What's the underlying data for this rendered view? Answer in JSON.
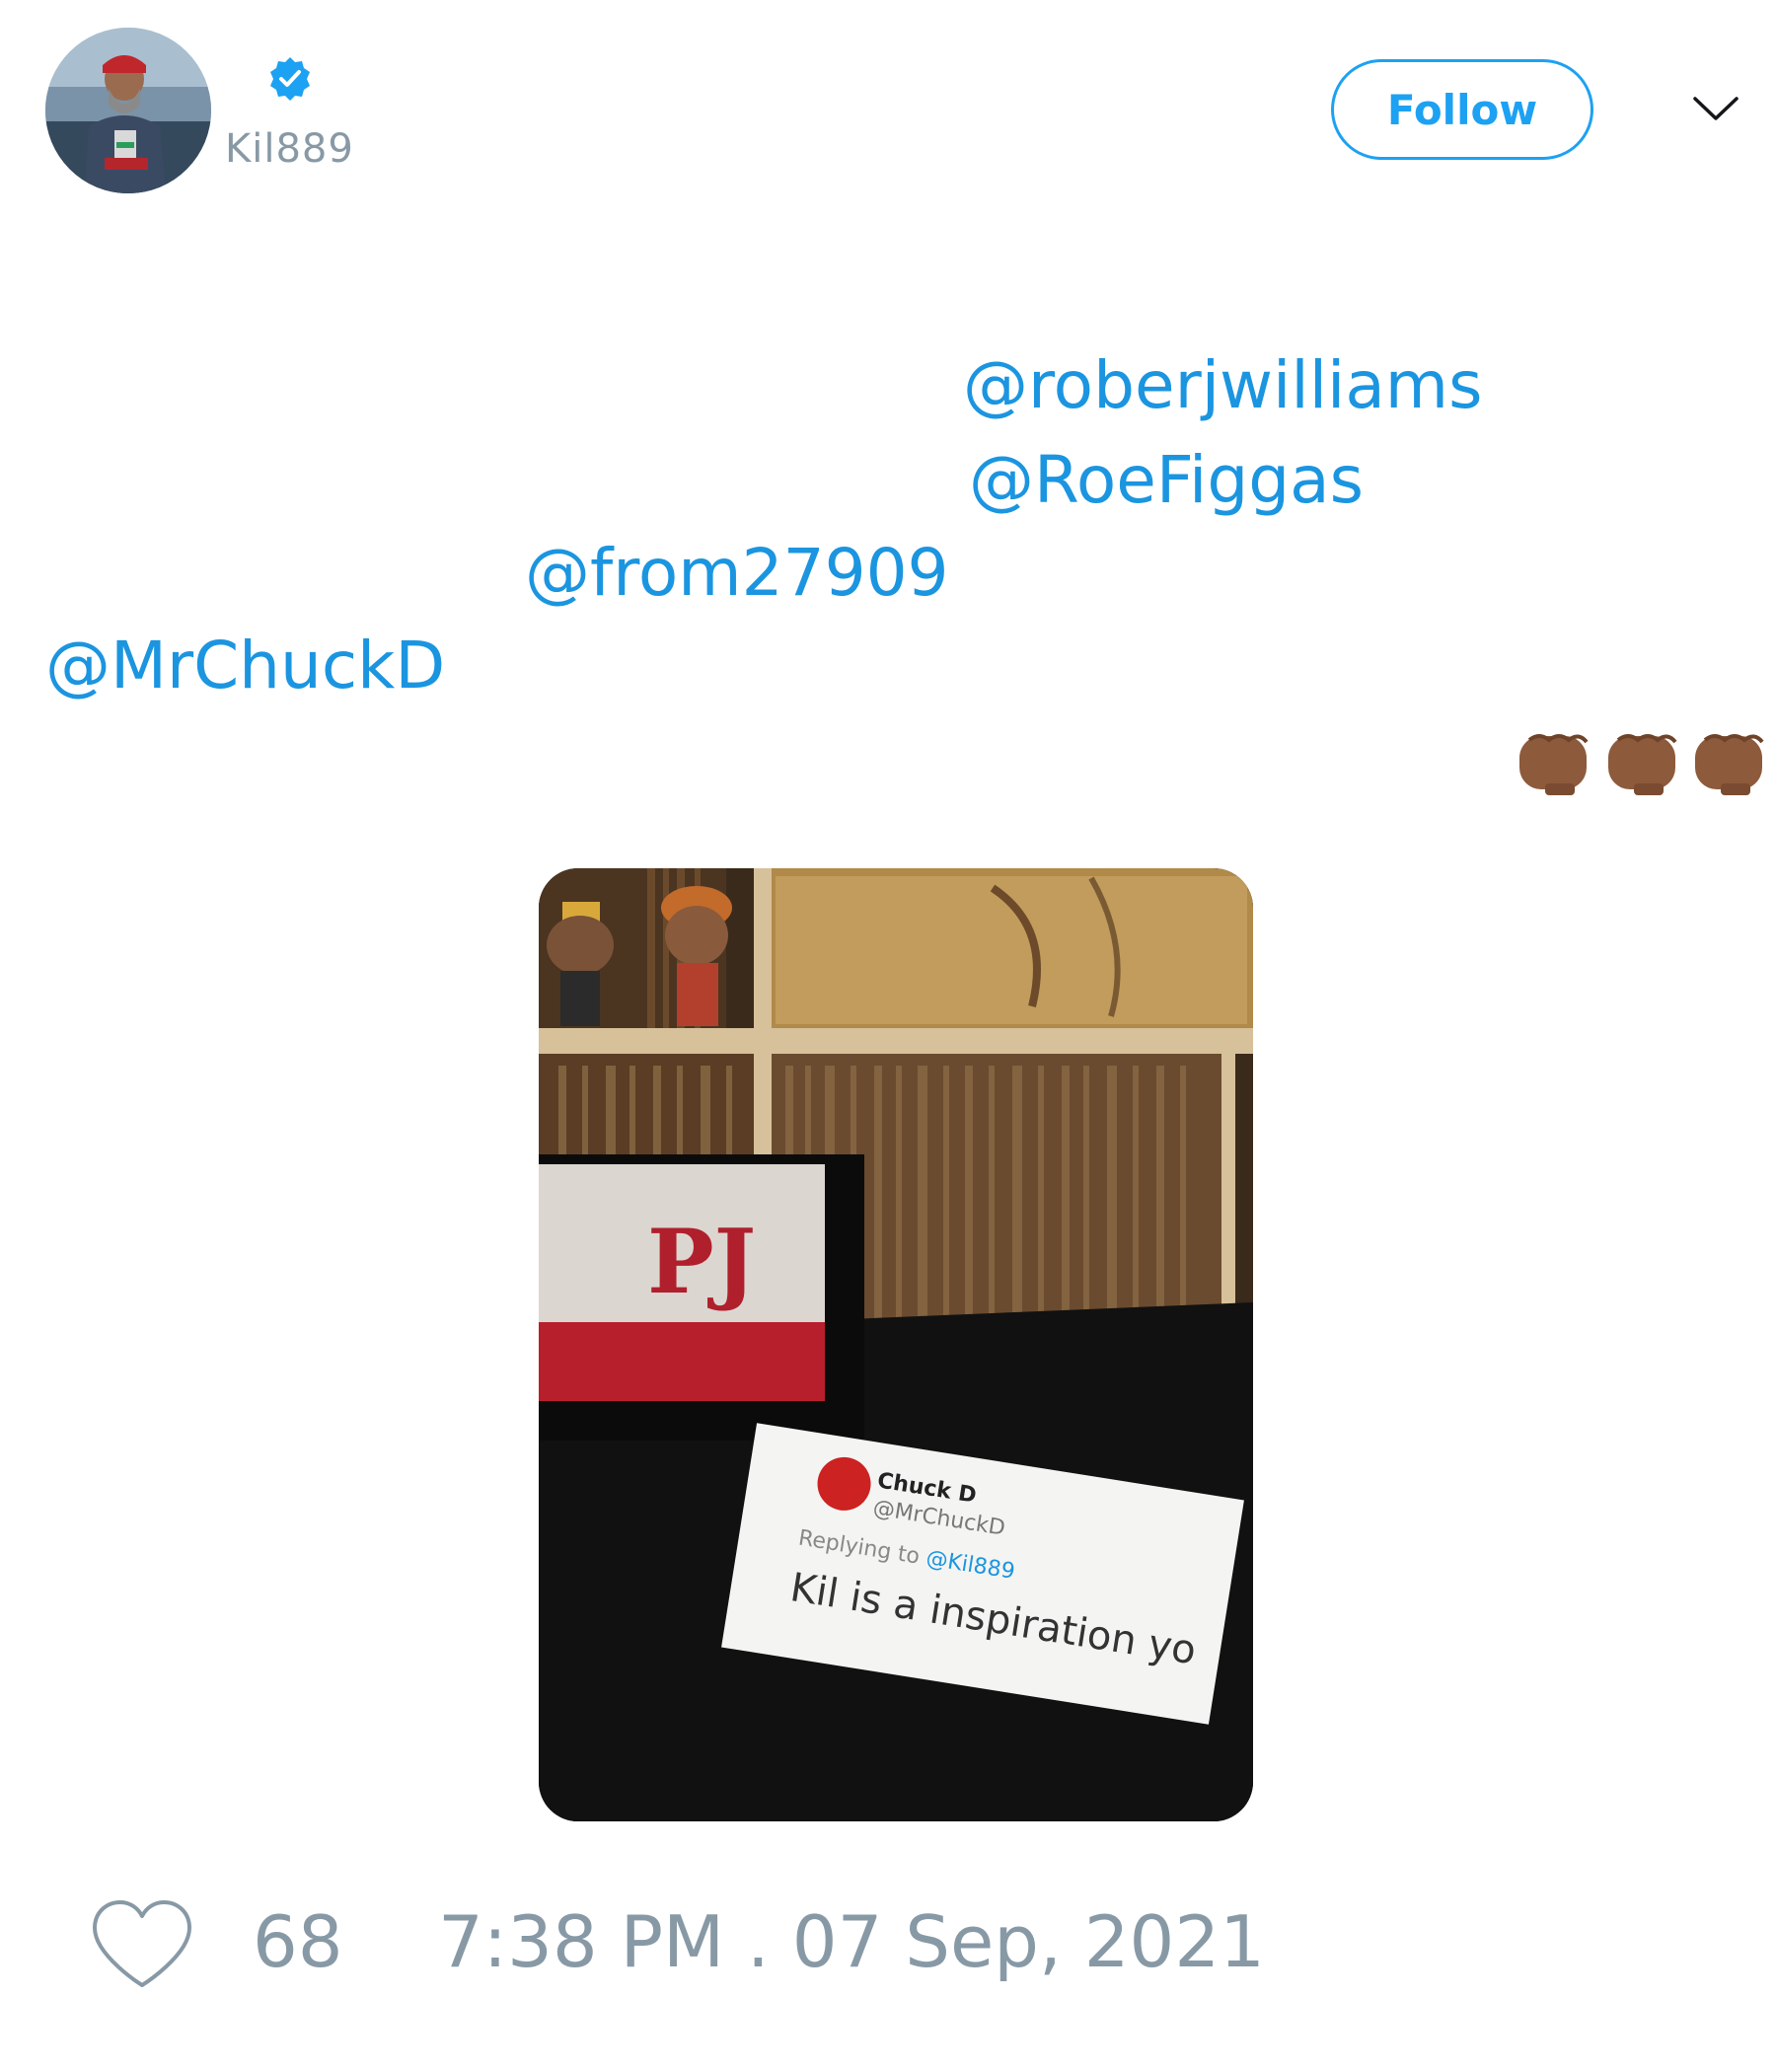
{
  "author": {
    "handle": "Kil889",
    "verified": true,
    "avatar": "profile-photo"
  },
  "actions": {
    "follow_label": "Follow",
    "menu_icon": "chevron-down-icon"
  },
  "tweet": {
    "mentions": [
      "@roberjwilliams",
      "@RoeFiggas",
      "@from27909",
      "@MrChuckD"
    ],
    "emoji": "👊🏾👊🏾👊🏾",
    "photo": {
      "description_text": {
        "name": "Chuck D",
        "handle": "@MrChuckD",
        "replying_prefix": "Replying to",
        "replying_handle": "@Kil889",
        "body": "Kil  is a inspiration yo"
      }
    }
  },
  "footer": {
    "likes": "68",
    "timestamp": "7:38 PM . 07 Sep, 2021"
  },
  "colors": {
    "accent": "#1da1f2",
    "link": "#1b95e0",
    "muted": "#8899a6"
  }
}
